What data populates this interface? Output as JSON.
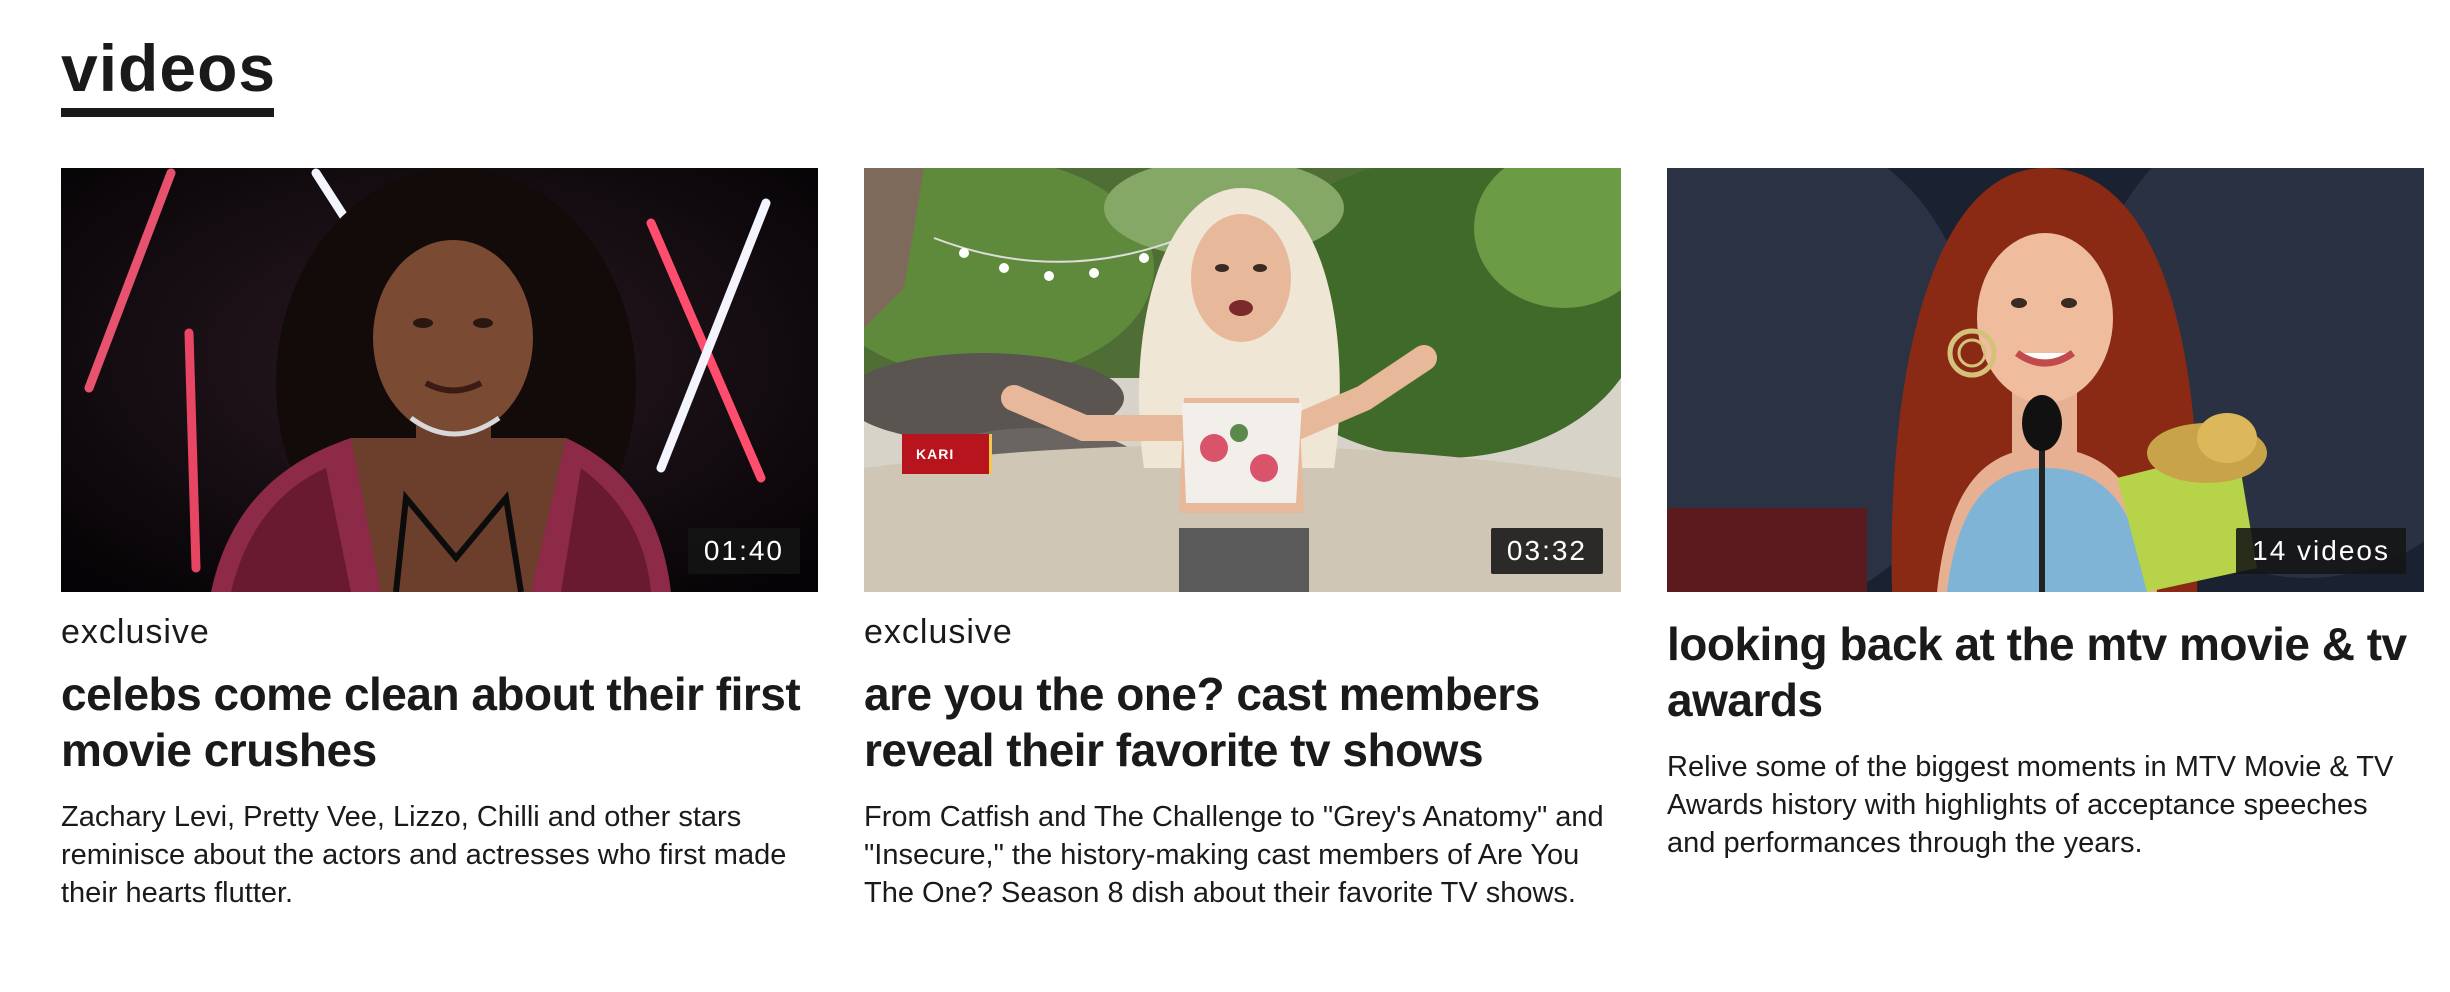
{
  "section": {
    "title": "videos"
  },
  "cards": [
    {
      "eyebrow": "exclusive",
      "headline": "celebs come clean about their first movie crushes",
      "description": "Zachary Levi, Pretty Vee, Lizzo, Chilli and other stars reminisce about the actors and actresses who first made their hearts flutter.",
      "badge": "01:40"
    },
    {
      "eyebrow": "exclusive",
      "headline": "are you the one? cast members reveal their favorite tv shows",
      "description": "From Catfish and The Challenge to \"Grey's Anatomy\" and \"Insecure,\" the history-making cast members of Are You The One? Season 8 dish about their favorite TV shows.",
      "badge": "03:32",
      "lower_third": "KARI"
    },
    {
      "headline": "looking back at the mtv movie & tv awards",
      "description": "Relive some of the biggest moments in MTV Movie & TV Awards history with highlights of acceptance speeches and performances through the years.",
      "badge": "14 videos"
    }
  ],
  "colors": {
    "text": "#1a1a1a",
    "badge_bg": "#141414",
    "lower_third_red": "#b8141e"
  }
}
